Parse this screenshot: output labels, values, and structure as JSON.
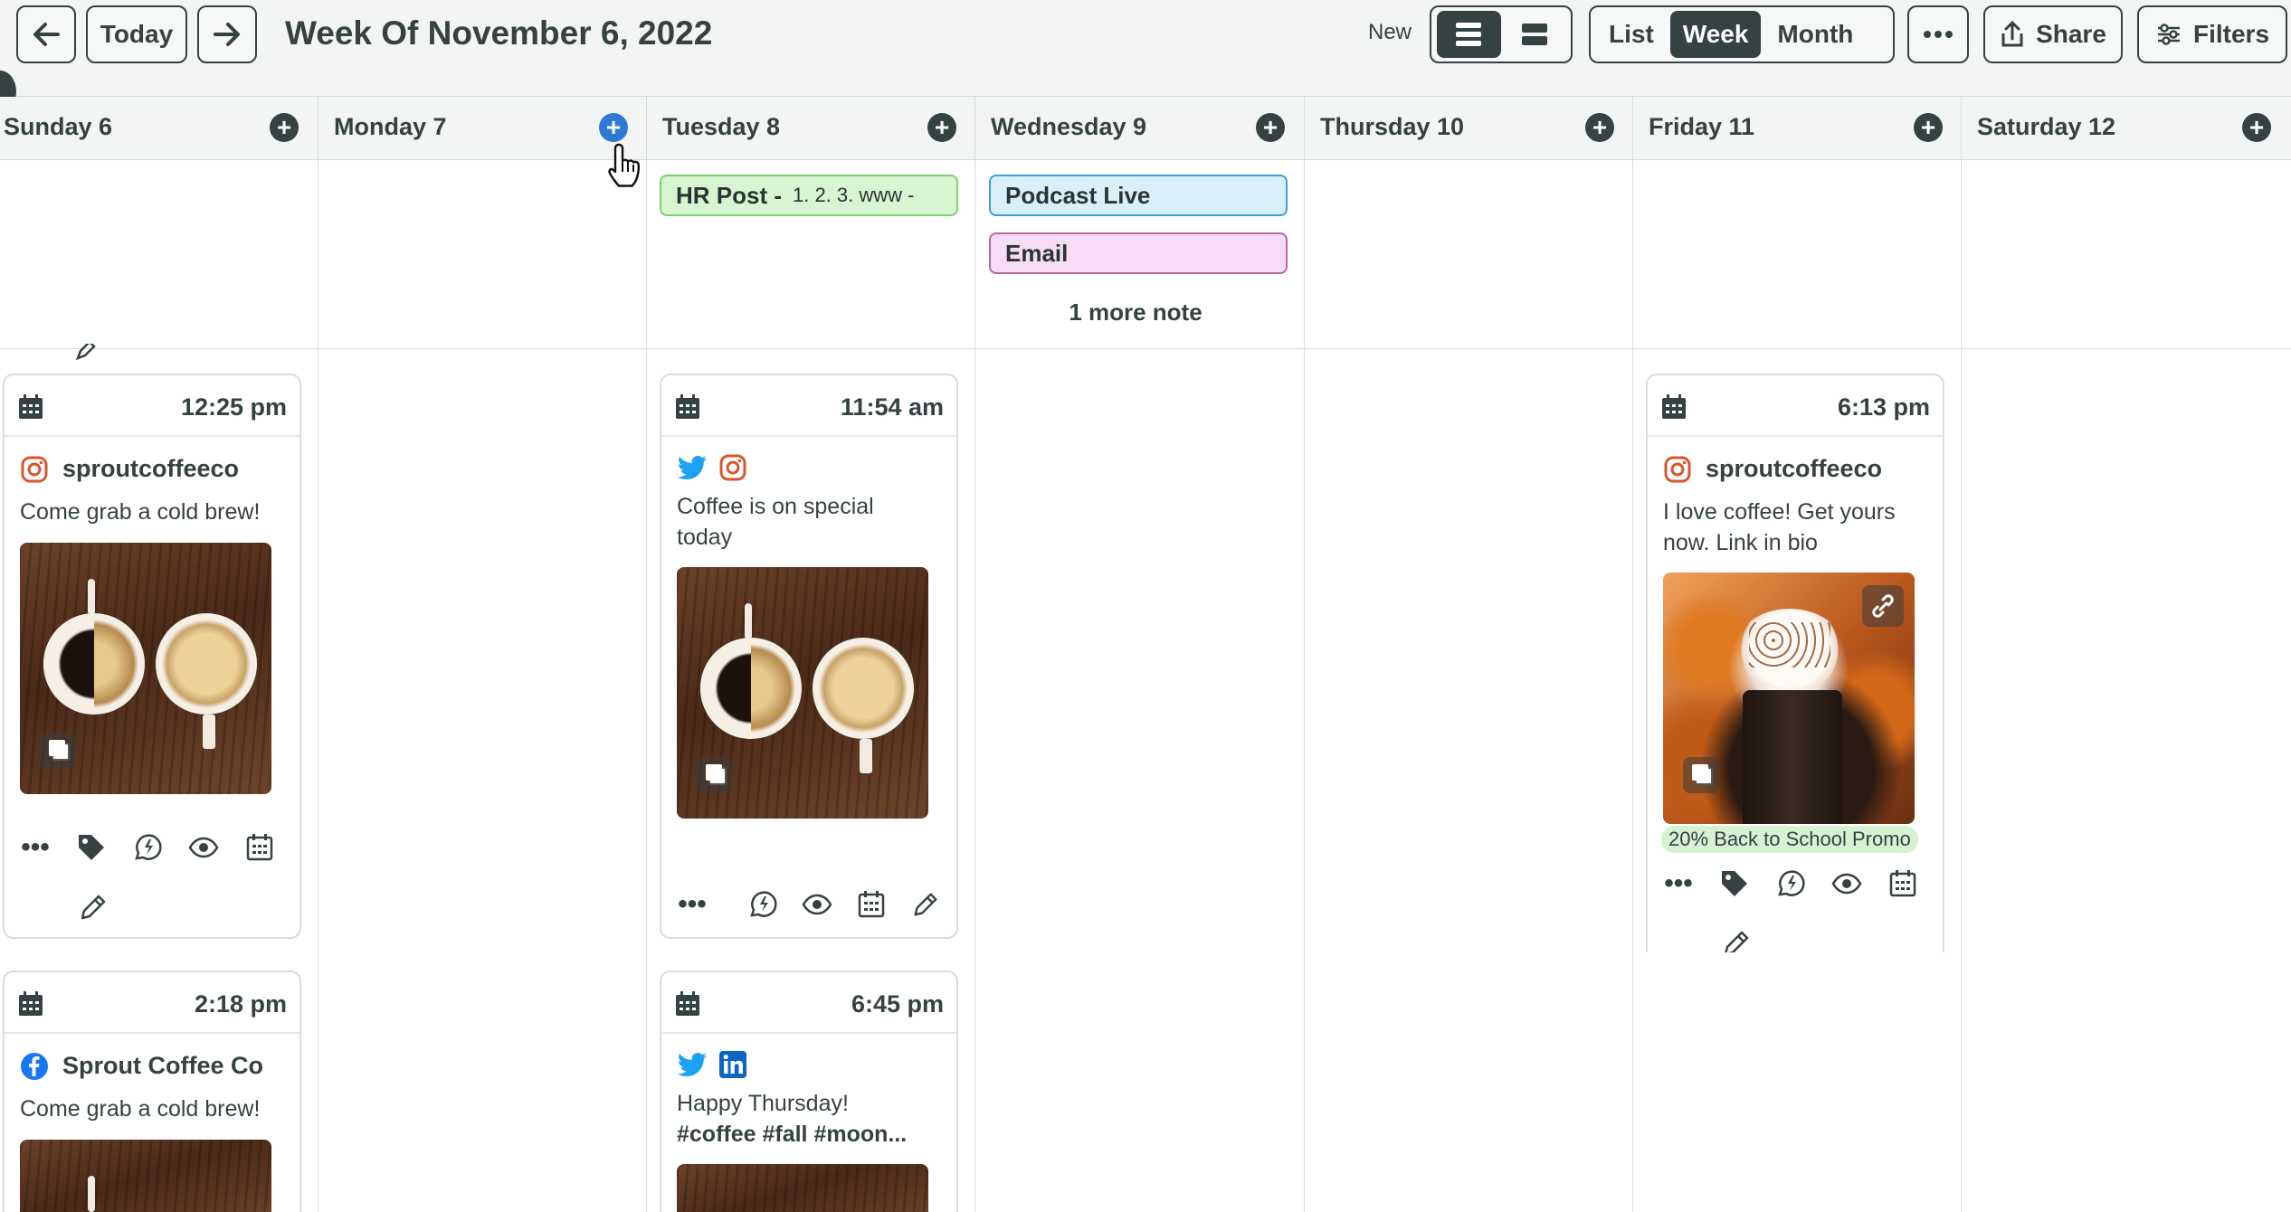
{
  "toolbar": {
    "back_icon": "arrow-left-icon",
    "today_label": "Today",
    "forward_icon": "arrow-right-icon",
    "title": "Week Of November 6, 2022",
    "new_label": "New",
    "view_modes": [
      "List",
      "Week",
      "Month"
    ],
    "active_view": "Week",
    "share_label": "Share",
    "filters_label": "Filters"
  },
  "days": [
    {
      "label": "Sunday 6"
    },
    {
      "label": "Monday 7"
    },
    {
      "label": "Tuesday 8"
    },
    {
      "label": "Wednesday 9"
    },
    {
      "label": "Thursday 10"
    },
    {
      "label": "Friday 11"
    },
    {
      "label": "Saturday 12"
    }
  ],
  "notes": {
    "tuesday": [
      {
        "title": "HR Post -",
        "detail": "1. 2. 3. www -",
        "color": "#d6f5d0",
        "border": "#7fcf73"
      }
    ],
    "wednesday": [
      {
        "title": "Podcast Live",
        "color": "#d9f0fb",
        "border": "#3aa0d8"
      },
      {
        "title": "Email",
        "color": "#f8dcf5",
        "border": "#b06aa6"
      }
    ],
    "wednesday_more": "1 more note"
  },
  "posts": {
    "sun_1": {
      "time": "12:25 pm",
      "account": "sproutcoffeeco",
      "network": "instagram-icon",
      "text": "Come grab a cold brew!"
    },
    "sun_2": {
      "time": "2:18 pm",
      "account": "Sprout Coffee Co",
      "network": "facebook-icon",
      "text": "Come grab a cold brew!"
    },
    "tue_1": {
      "time": "11:54 am",
      "networks": [
        "twitter-icon",
        "instagram-icon"
      ],
      "text_lines": [
        "Coffee is on special",
        "today"
      ]
    },
    "tue_2": {
      "time": "6:45 pm",
      "networks": [
        "twitter-icon",
        "linkedin-icon"
      ],
      "text_lines": [
        "Happy Thursday!",
        "#coffee #fall #moon..."
      ]
    },
    "fri_1": {
      "time": "6:13 pm",
      "account": "sproutcoffeeco",
      "network": "instagram-icon",
      "text_lines": [
        "I love coffee! Get yours",
        "now. Link in bio"
      ],
      "tag": "20% Back to School Promo"
    }
  },
  "colors": {
    "ink": "#364141",
    "accent_blue": "#2f78d4",
    "twitter": "#1da1f2",
    "instagram": "#d9572b",
    "facebook": "#1877f2",
    "linkedin": "#0a66c2"
  }
}
